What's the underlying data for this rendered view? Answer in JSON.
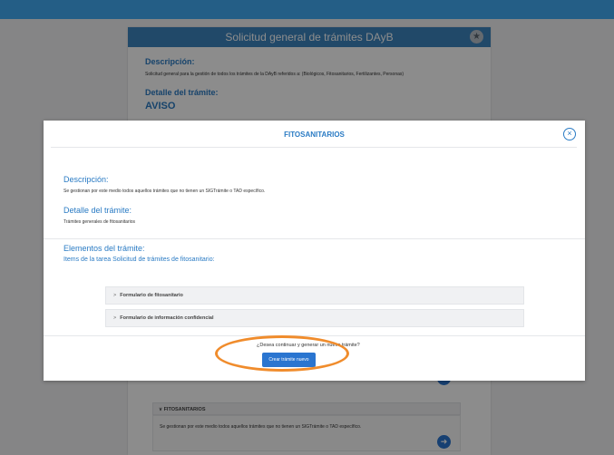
{
  "background": {
    "card_title": "Solicitud general de trámites DAyB",
    "descripcion_heading": "Descripción:",
    "descripcion_text": "Solicitud general para la gestión de todos los trámites de la DAyB referidos a: (Biológicos, Fitosanitarios, Fertilizantes, Personas)",
    "detalle_heading": "Detalle del trámite:",
    "aviso_heading": "AVISO",
    "accordion_label": "FITOSANITARIOS",
    "accordion_text": "Se gestionan por este medio todos aquellos trámites que no tienen un SIGTrámite o TAD específico."
  },
  "modal": {
    "title": "FITOSANITARIOS",
    "descripcion_heading": "Descripción:",
    "descripcion_text": "Se gestionan por este medio todos aquellos trámites que no tienen un SIGTrámite o TAD específico.",
    "detalle_heading": "Detalle del trámite:",
    "detalle_text": "Trámites generales de fitosanitarios",
    "elementos_heading": "Elementos del trámite:",
    "items_title": "Items de la tarea Solicitud de trámites de fitosanitario:",
    "items": [
      {
        "label": "Formulario de fitosanitario"
      },
      {
        "label": "Formulario de información confidencial"
      }
    ],
    "question": "¿Desea continuar y generar un nuevo trámite?",
    "create_button": "Crear trámite nuevo"
  },
  "icons": {
    "star": "star-icon",
    "close": "close-icon",
    "chevron": "chevron-right-icon",
    "arrow": "arrow-right-icon"
  },
  "colors": {
    "topbar": "#245e86",
    "header": "#3d86c0",
    "accent": "#2a7bc4",
    "button": "#2a75d0",
    "highlight": "#f08c2c"
  }
}
